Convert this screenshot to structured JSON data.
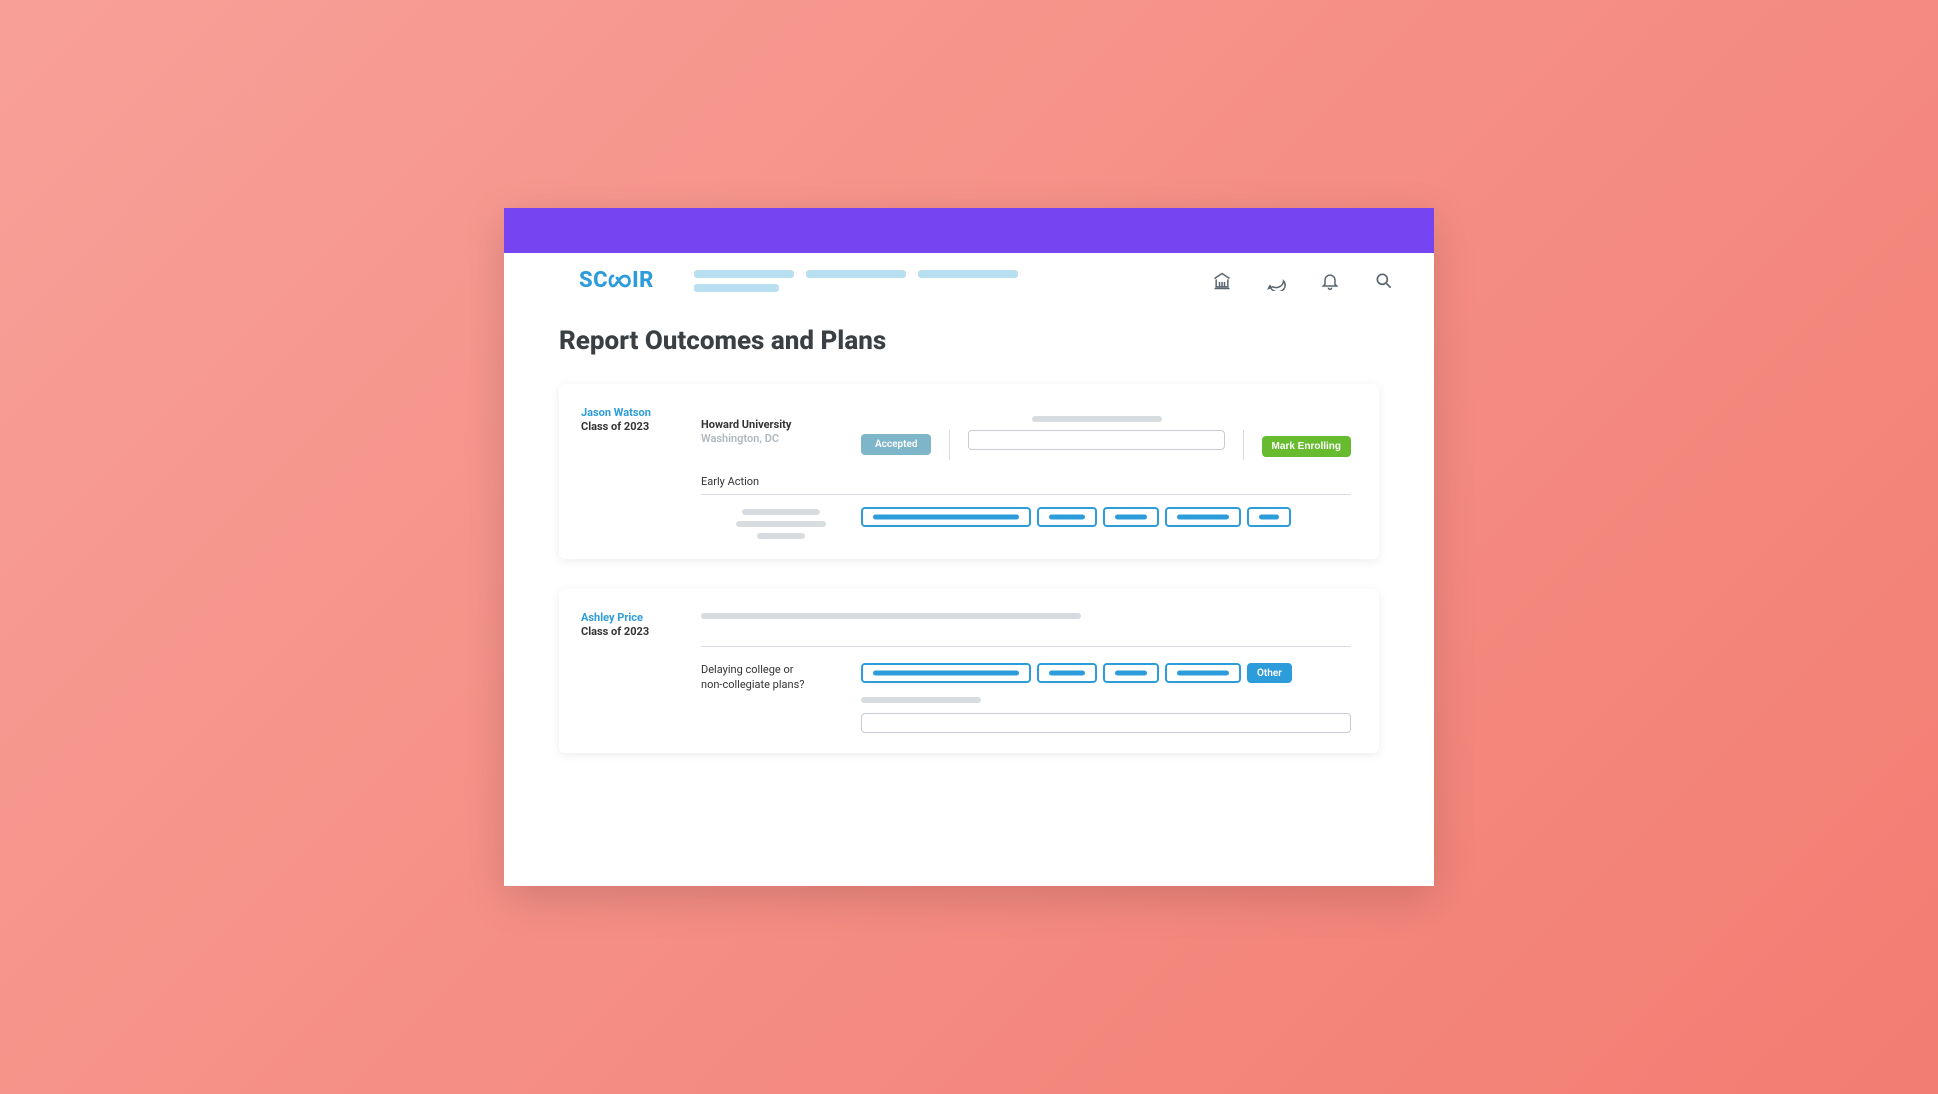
{
  "logo_text_left": "SC",
  "logo_text_right": "IR",
  "page_title": "Report Outcomes and Plans",
  "icons": {
    "institution": "institution-icon",
    "chat": "chat-icon",
    "bell": "bell-icon",
    "search": "search-icon"
  },
  "cards": [
    {
      "student_name": "Jason Watson",
      "student_class": "Class of 2023",
      "university_name": "Howard University",
      "university_location": "Washington, DC",
      "application_type": "Early Action",
      "status_label": "Accepted",
      "action_label": "Mark Enrolling"
    },
    {
      "student_name": "Ashley Price",
      "student_class": "Class of 2023",
      "delay_prompt_line1": "Delaying college or",
      "delay_prompt_line2": "non-collegiate plans?",
      "other_label": "Other"
    }
  ]
}
